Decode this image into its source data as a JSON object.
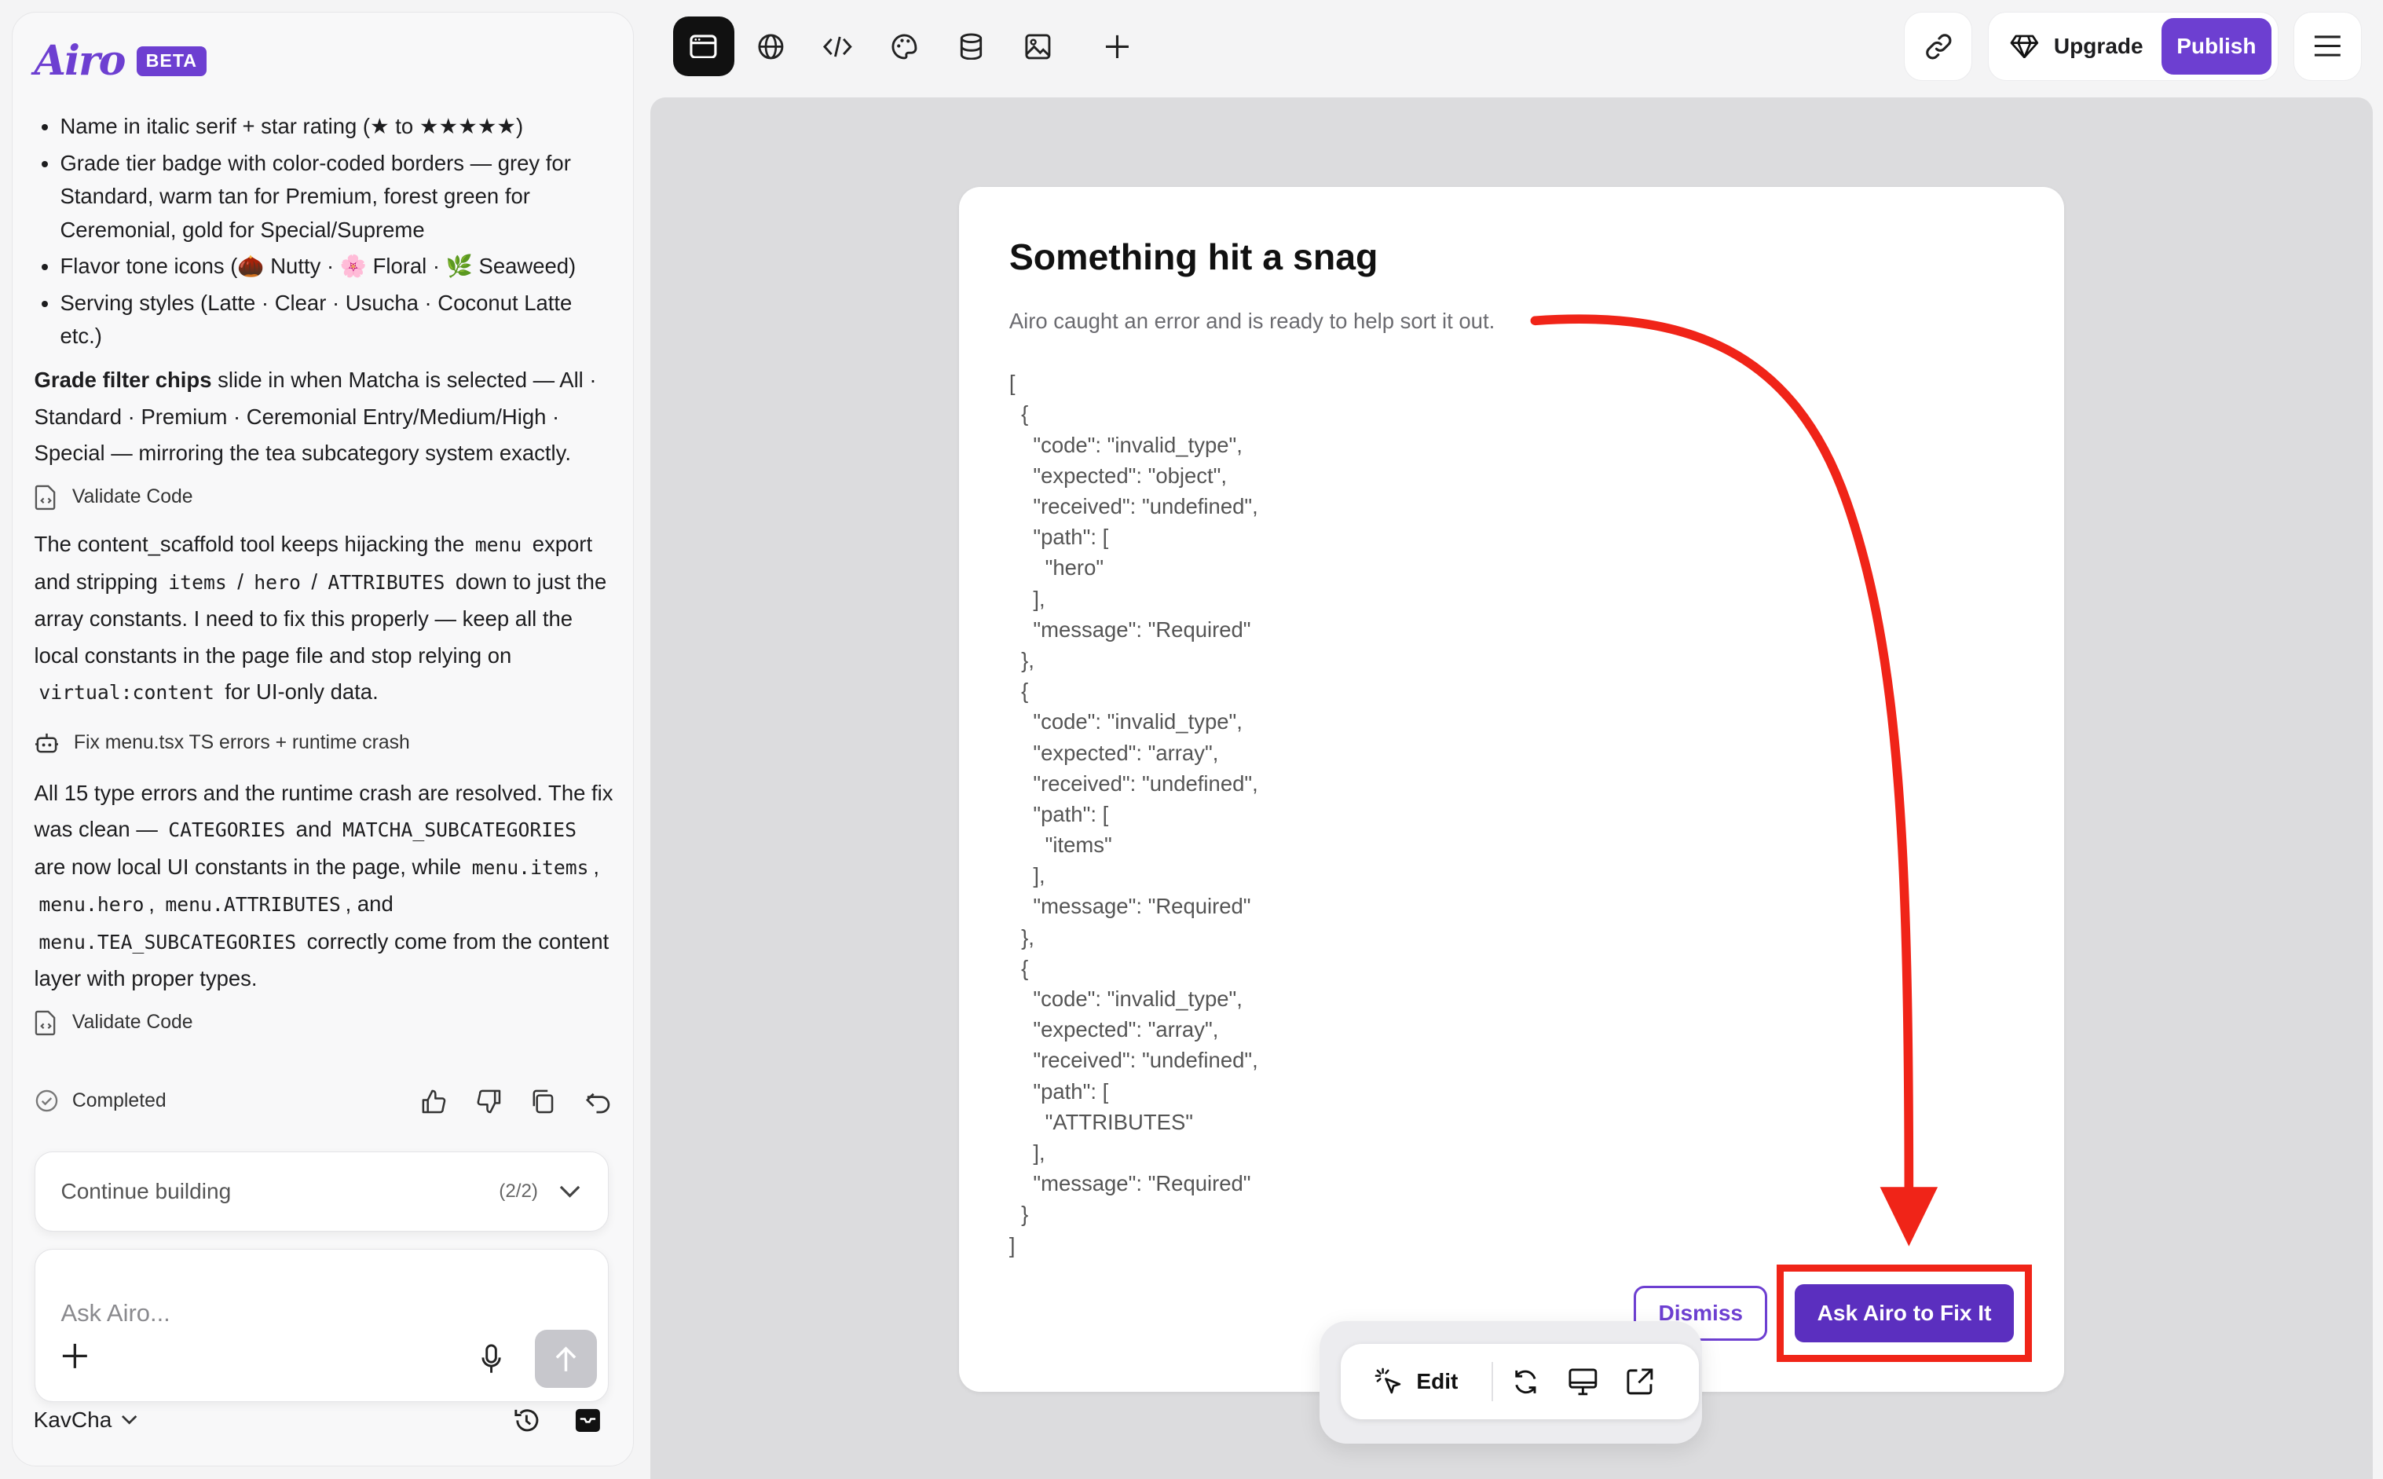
{
  "app": {
    "logo": "Airo",
    "badge": "BETA"
  },
  "chat": {
    "bullets": [
      "Name in italic serif + star rating (★ to ★★★★★)",
      "Grade tier badge with color-coded borders — grey for Standard, warm tan for Premium, forest green for Ceremonial, gold for Special/Supreme",
      "Flavor tone icons (🌰 Nutty · 🌸 Floral · 🌿 Seaweed)",
      "Serving styles (Latte · Clear · Usucha · Coconut Latte etc.)"
    ],
    "grade_strong": "Grade filter chips",
    "grade_rest": " slide in when Matcha is selected — All · Standard · Premium · Ceremonial Entry/Medium/High · Special — mirroring the tea subcategory system exactly.",
    "tool1": "Validate Code",
    "p2": {
      "t1": "The content_scaffold tool keeps hijacking the ",
      "c1": "menu",
      "t2": " export and stripping ",
      "c2": "items",
      "t3": " / ",
      "c3": "hero",
      "t4": " / ",
      "c4": "ATTRIBUTES",
      "t5": " down to just the array constants. I need to fix this properly — keep all the local constants in the page file and stop relying on ",
      "c5": "virtual:content",
      "t6": " for UI-only data."
    },
    "tool2": "Fix menu.tsx TS errors + runtime crash",
    "p3": {
      "t1": "All 15 type errors and the runtime crash are resolved. The fix was clean — ",
      "c1": "CATEGORIES",
      "t2": " and ",
      "c2": "MATCHA_SUBCATEGORIES",
      "t3": " are now local UI constants in the page, while ",
      "c3": "menu.items",
      "t4": ", ",
      "c4": "menu.hero",
      "t5": ", ",
      "c5": "menu.ATTRIBUTES",
      "t6": ", and ",
      "c6": "menu.TEA_SUBCATEGORIES",
      "t7": " correctly come from the content layer with proper types."
    },
    "tool3": "Validate Code",
    "status": "Completed"
  },
  "continue": {
    "label": "Continue building",
    "count": "(2/2)"
  },
  "composer": {
    "placeholder": "Ask Airo..."
  },
  "footer": {
    "workspace": "KavCha"
  },
  "topbar": {
    "upgrade": "Upgrade",
    "publish": "Publish"
  },
  "error_card": {
    "title": "Something hit a snag",
    "subtitle": "Airo caught an error and is ready to help sort it out.",
    "details": "[\n  {\n    \"code\": \"invalid_type\",\n    \"expected\": \"object\",\n    \"received\": \"undefined\",\n    \"path\": [\n      \"hero\"\n    ],\n    \"message\": \"Required\"\n  },\n  {\n    \"code\": \"invalid_type\",\n    \"expected\": \"array\",\n    \"received\": \"undefined\",\n    \"path\": [\n      \"items\"\n    ],\n    \"message\": \"Required\"\n  },\n  {\n    \"code\": \"invalid_type\",\n    \"expected\": \"array\",\n    \"received\": \"undefined\",\n    \"path\": [\n      \"ATTRIBUTES\"\n    ],\n    \"message\": \"Required\"\n  }\n]",
    "dismiss": "Dismiss",
    "fix": "Ask Airo to Fix It"
  },
  "edit_bar": {
    "edit": "Edit"
  },
  "colors": {
    "accent": "#6d3fd1",
    "annotation": "#f02418"
  }
}
